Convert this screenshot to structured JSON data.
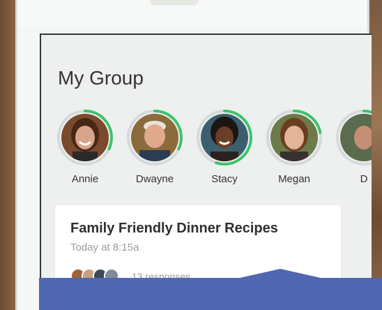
{
  "group": {
    "title": "My Group"
  },
  "members": [
    {
      "name": "Annie",
      "progress": 0.32
    },
    {
      "name": "Dwayne",
      "progress": 0.32
    },
    {
      "name": "Stacy",
      "progress": 0.55
    },
    {
      "name": "Megan",
      "progress": 0.22
    },
    {
      "name": "D",
      "progress": 0.2
    }
  ],
  "post": {
    "title": "Family Friendly Dinner Recipes",
    "time": "Today at 8:15a",
    "responses": "13 responses"
  },
  "colors": {
    "progress_ring": "#3cc46b",
    "banner": "#4f66b0"
  }
}
